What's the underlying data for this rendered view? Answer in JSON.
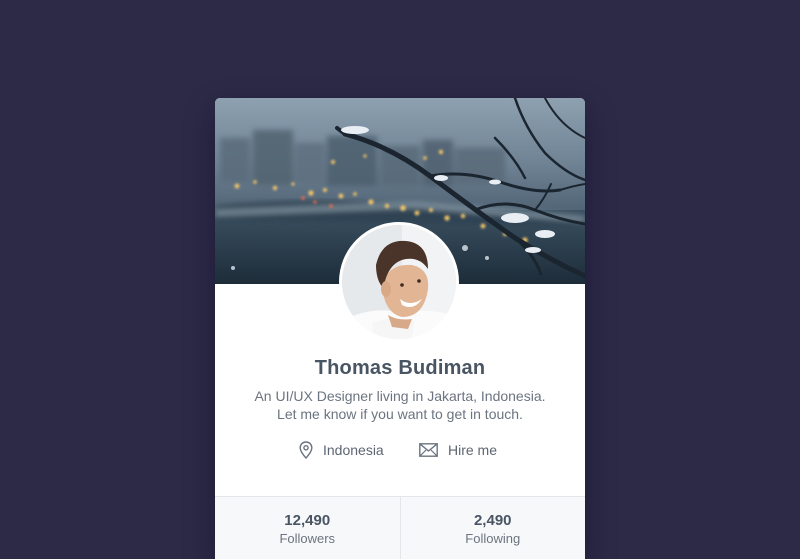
{
  "profile": {
    "name": "Thomas Budiman",
    "bio_line1": "An UI/UX Designer living in Jakarta, Indonesia.",
    "bio_line2": "Let me know if you want to get in touch.",
    "location": "Indonesia",
    "location_icon": "map-pin-icon",
    "hire_label": "Hire me",
    "hire_icon": "mail-icon"
  },
  "stats": [
    {
      "value": "12,490",
      "label": "Followers"
    },
    {
      "value": "2,490",
      "label": "Following"
    }
  ],
  "colors": {
    "background": "#2d2a48",
    "card": "#ffffff",
    "text_primary": "#4a5563",
    "text_secondary": "#6b7480",
    "stats_background": "#f7f8f9"
  }
}
